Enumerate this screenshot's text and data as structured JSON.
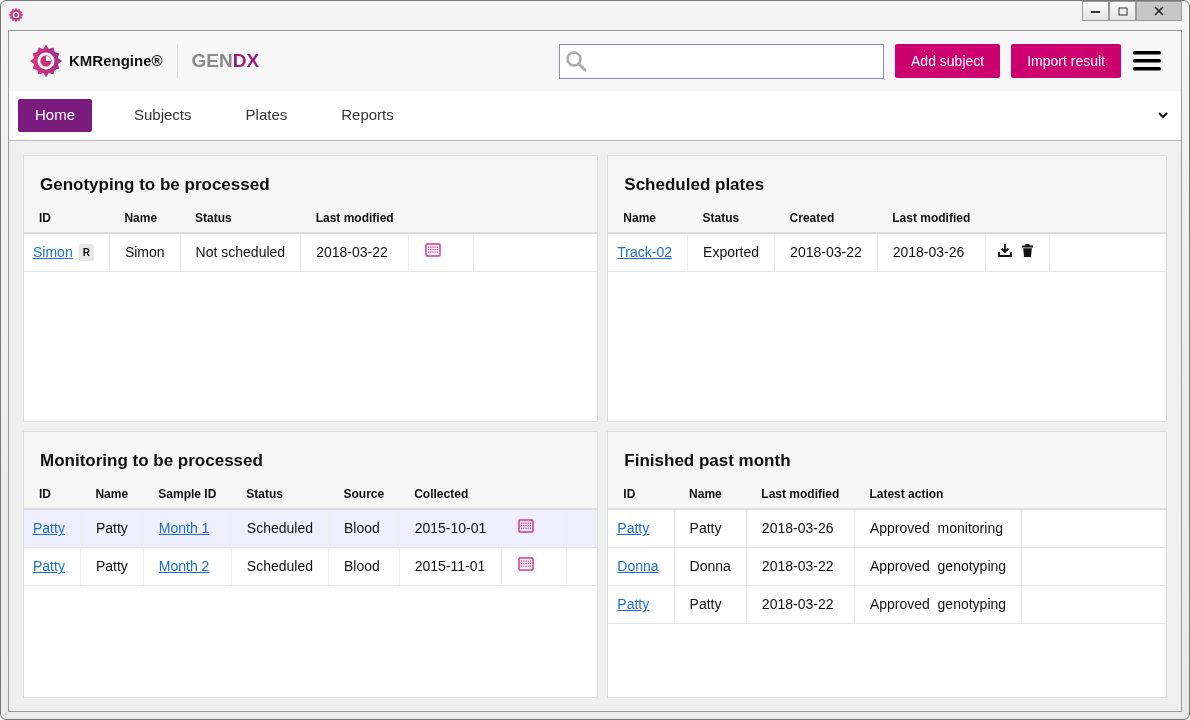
{
  "brand": {
    "name": "KMRengine®",
    "partner": [
      {
        "text": "GEN",
        "accent": false
      },
      {
        "text": "DX",
        "accent": true
      }
    ]
  },
  "actions": [
    "Add subject",
    "Import result"
  ],
  "tabs": [
    {
      "label": "Home",
      "selected": true
    },
    {
      "label": "Subjects",
      "selected": false
    },
    {
      "label": "Plates",
      "selected": false
    },
    {
      "label": "Reports",
      "selected": false
    }
  ],
  "panels": [
    {
      "title": "Genotyping to be processed",
      "columns": [
        "ID",
        "Name",
        "Status",
        "Last modified",
        ""
      ],
      "rows": [
        {
          "selected": false,
          "cells": [
            {
              "kind": "link",
              "text": "Simon",
              "badge": "R"
            },
            {
              "kind": "text",
              "text": "Simon"
            },
            {
              "kind": "text",
              "text": "Not scheduled"
            },
            {
              "kind": "text",
              "text": "2018-03-22"
            },
            {
              "kind": "schedule"
            }
          ]
        }
      ]
    },
    {
      "title": "Scheduled plates",
      "columns": [
        "Name",
        "Status",
        "Created",
        "Last modified",
        ""
      ],
      "rows": [
        {
          "selected": false,
          "cells": [
            {
              "kind": "link",
              "text": "Track-02"
            },
            {
              "kind": "text",
              "text": "Exported"
            },
            {
              "kind": "text",
              "text": "2018-03-22"
            },
            {
              "kind": "text",
              "text": "2018-03-26"
            },
            {
              "kind": "file-actions"
            }
          ]
        }
      ]
    },
    {
      "title": "Monitoring to be processed",
      "columns": [
        "ID",
        "Name",
        "Sample ID",
        "Status",
        "Source",
        "Collected",
        ""
      ],
      "rows": [
        {
          "selected": true,
          "cells": [
            {
              "kind": "link",
              "text": "Patty"
            },
            {
              "kind": "text",
              "text": "Patty"
            },
            {
              "kind": "link",
              "text": "Month 1"
            },
            {
              "kind": "text",
              "text": "Scheduled"
            },
            {
              "kind": "text",
              "text": "Blood"
            },
            {
              "kind": "text",
              "text": "2015-10-01"
            },
            {
              "kind": "schedule"
            }
          ]
        },
        {
          "selected": false,
          "cells": [
            {
              "kind": "link",
              "text": "Patty"
            },
            {
              "kind": "text",
              "text": "Patty"
            },
            {
              "kind": "link",
              "text": "Month 2"
            },
            {
              "kind": "text",
              "text": "Scheduled"
            },
            {
              "kind": "text",
              "text": "Blood"
            },
            {
              "kind": "text",
              "text": "2015-11-01"
            },
            {
              "kind": "schedule"
            }
          ]
        }
      ]
    },
    {
      "title": "Finished past month",
      "columns": [
        "ID",
        "Name",
        "Last modified",
        "Latest action"
      ],
      "rows": [
        {
          "selected": false,
          "cells": [
            {
              "kind": "link",
              "text": "Patty"
            },
            {
              "kind": "text",
              "text": "Patty"
            },
            {
              "kind": "text",
              "text": "2018-03-26"
            },
            {
              "kind": "text",
              "text": "Approved  monitoring"
            }
          ]
        },
        {
          "selected": false,
          "cells": [
            {
              "kind": "link",
              "text": "Donna"
            },
            {
              "kind": "text",
              "text": "Donna"
            },
            {
              "kind": "text",
              "text": "2018-03-22"
            },
            {
              "kind": "text",
              "text": "Approved  genotyping"
            }
          ]
        },
        {
          "selected": false,
          "cells": [
            {
              "kind": "link",
              "text": "Patty"
            },
            {
              "kind": "text",
              "text": "Patty"
            },
            {
              "kind": "text",
              "text": "2018-03-22"
            },
            {
              "kind": "text",
              "text": "Approved  genotyping"
            }
          ]
        }
      ]
    }
  ]
}
